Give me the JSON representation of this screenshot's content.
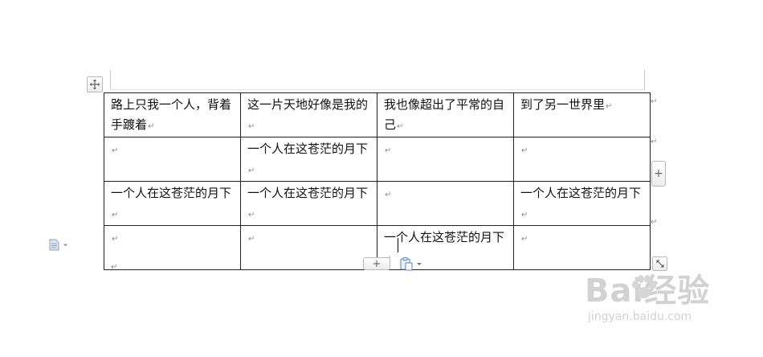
{
  "table": {
    "rows": [
      [
        "路上只我一个人，背着手踱着",
        "这一片天地好像是我的",
        "我也像超出了平常的自己",
        "到了另一世界里"
      ],
      [
        "",
        "一个人在这苍茫的月下",
        "",
        ""
      ],
      [
        "一个人在这苍茫的月下",
        "一个人在这苍茫的月下",
        "",
        "一个人在这苍茫的月下"
      ],
      [
        "",
        "",
        "一个人在这苍茫的月下",
        ""
      ]
    ]
  },
  "marks": {
    "paragraph": "↵"
  },
  "controls": {
    "add_row_label": "+",
    "add_column_label": "+"
  },
  "watermark": {
    "logo_text": "Bai经验",
    "url_text": "jingyan.baidu.com"
  }
}
